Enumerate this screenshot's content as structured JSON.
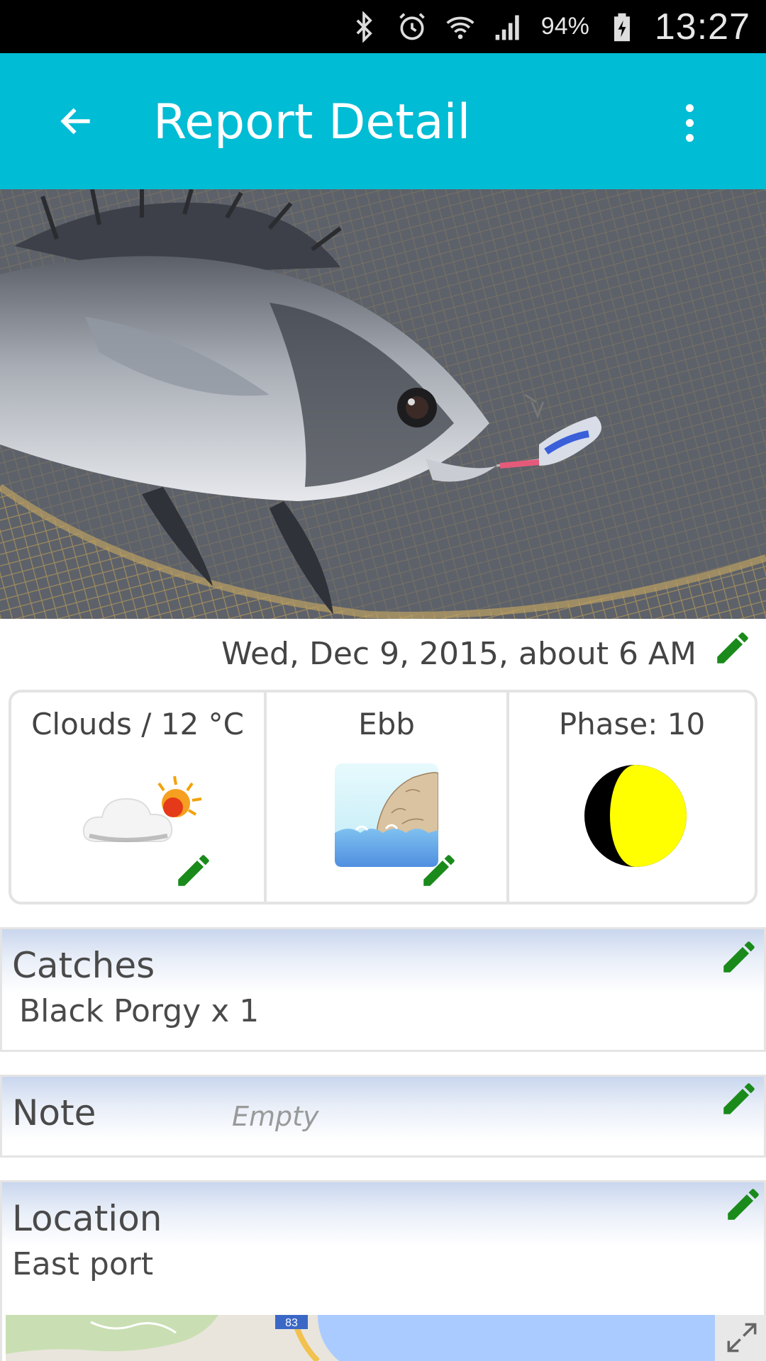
{
  "status_bar": {
    "battery_percent": "94%",
    "time": "13:27",
    "icons": [
      "bluetooth-icon",
      "alarm-icon",
      "wifi-icon",
      "signal-icon",
      "battery-charging-icon"
    ]
  },
  "app_bar": {
    "title": "Report Detail",
    "color": "#00BCD4",
    "back_icon": "arrow-back-icon",
    "menu_icon": "more-vert-icon"
  },
  "report": {
    "date": "Wed, Dec 9, 2015, about 6 AM",
    "conditions": {
      "weather": {
        "label": "Clouds / 12 °C",
        "icon": "cloud-sun-icon"
      },
      "tide": {
        "label": "Ebb",
        "icon": "tide-ebb-icon"
      },
      "moon": {
        "label": "Phase: 10",
        "icon": "moon-phase-icon"
      }
    },
    "catches": {
      "title": "Catches",
      "items": [
        "Black Porgy x 1"
      ]
    },
    "note": {
      "title": "Note",
      "placeholder": "Empty"
    },
    "location": {
      "title": "Location",
      "value": "East port",
      "map_badge": "83"
    }
  },
  "colors": {
    "accent": "#00BCD4",
    "edit_icon": "#1a8a1a",
    "moon": "#FFFF00"
  }
}
